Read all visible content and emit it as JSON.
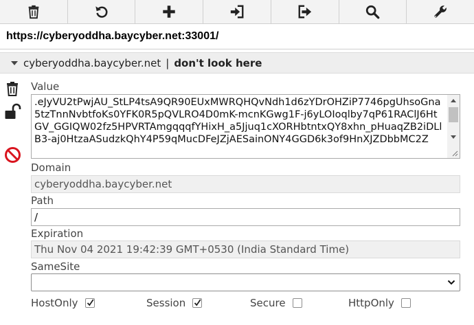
{
  "toolbar": {
    "buttons": [
      {
        "name": "delete-all",
        "icon": "trash-icon"
      },
      {
        "name": "reset",
        "icon": "refresh-icon"
      },
      {
        "name": "add",
        "icon": "plus-icon"
      },
      {
        "name": "import",
        "icon": "import-icon"
      },
      {
        "name": "export",
        "icon": "export-icon"
      },
      {
        "name": "search",
        "icon": "search-icon"
      },
      {
        "name": "options",
        "icon": "wrench-icon"
      }
    ]
  },
  "url": "https://cyberyoddha.baycyber.net:33001/",
  "cookie": {
    "domain_header": "cyberyoddha.baycyber.net",
    "separator": "|",
    "name": "don't look here",
    "labels": {
      "value": "Value",
      "domain": "Domain",
      "path": "Path",
      "expiration": "Expiration",
      "samesite": "SameSite"
    },
    "value": ".eJyVU2tPwjAU_StLP4tsA9QR90EUxMWRQHQvNdh1d6zYDrOHZiP7746pgUhsoGna5tzTnnNvbtfoKs0YFK0R5pQVLRO4D0mK-mcnKGwg1F-j6yLOIoqlby7qP61RAClJ6HtGV_GGIQW02fz5HPVRTAmgqqqfYHixH_a5Jjuq1cXORHbtntxQY8xhn_pHuaqZB2iDLlB3-aj0HtzaASudzkQhY4P59qMucDFeJZjAESainONY4GGD6k3of9HnXJZDbbMC2Z",
    "domain": "cyberyoddha.baycyber.net",
    "path": "/",
    "expiration": "Thu Nov 04 2021 19:42:39 GMT+0530 (India Standard Time)",
    "samesite": "",
    "flags": [
      {
        "label": "HostOnly",
        "checked": true
      },
      {
        "label": "Session",
        "checked": true
      },
      {
        "label": "Secure",
        "checked": false
      },
      {
        "label": "HttpOnly",
        "checked": false
      }
    ]
  },
  "side_icons": [
    "trash-icon",
    "unlock-icon",
    "block-icon"
  ],
  "colors": {
    "block_red": "#d9141e",
    "icon_dark": "#222222"
  }
}
